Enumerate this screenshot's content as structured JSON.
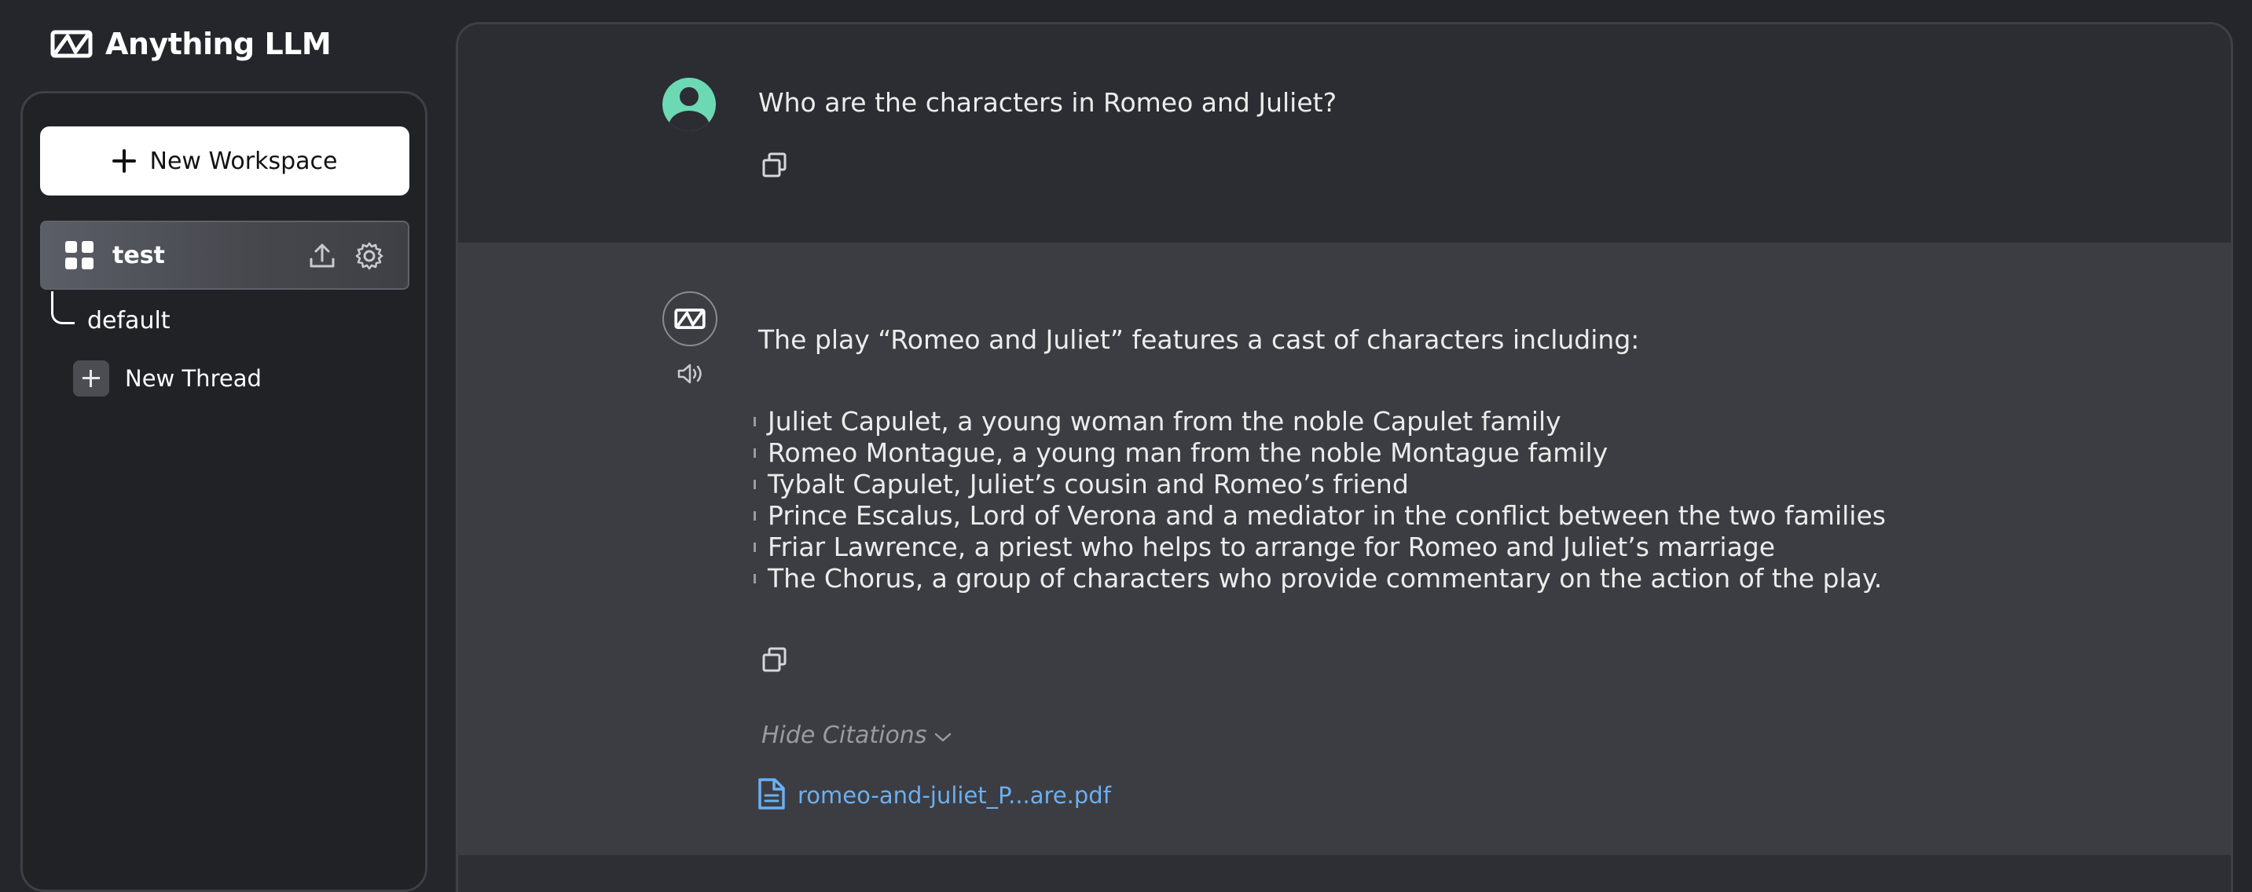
{
  "app": {
    "brand_name": "Anything LLM",
    "brand_icon": "anything-llm-logo-icon"
  },
  "sidebar": {
    "new_workspace_label": "New Workspace",
    "workspace": {
      "name": "test",
      "icons": [
        "upload-icon",
        "gear-icon"
      ]
    },
    "threads": [
      {
        "label": "default"
      }
    ],
    "new_thread_label": "New Thread"
  },
  "chat": {
    "user_message": {
      "text": "Who are the characters in Romeo and Juliet?"
    },
    "assistant_message": {
      "intro": "The play “Romeo and Juliet” features a cast of characters including:",
      "items": [
        "Juliet Capulet, a young woman from the noble Capulet family",
        "Romeo Montague, a young man from the noble Montague family",
        "Tybalt Capulet, Juliet’s cousin and Romeo’s friend",
        "Prince Escalus, Lord of Verona and a mediator in the conflict between the two families",
        "Friar Lawrence, a priest who helps to arrange for Romeo and Juliet’s marriage",
        "The Chorus, a group of characters who provide commentary on the action of the play."
      ],
      "hide_citations_label": "Hide Citations",
      "citation_file": "romeo-and-juliet_P...are.pdf"
    }
  },
  "colors": {
    "background": "#25262b",
    "user_avatar": "#6cd9b4",
    "citation_link": "#6ab0f3"
  }
}
